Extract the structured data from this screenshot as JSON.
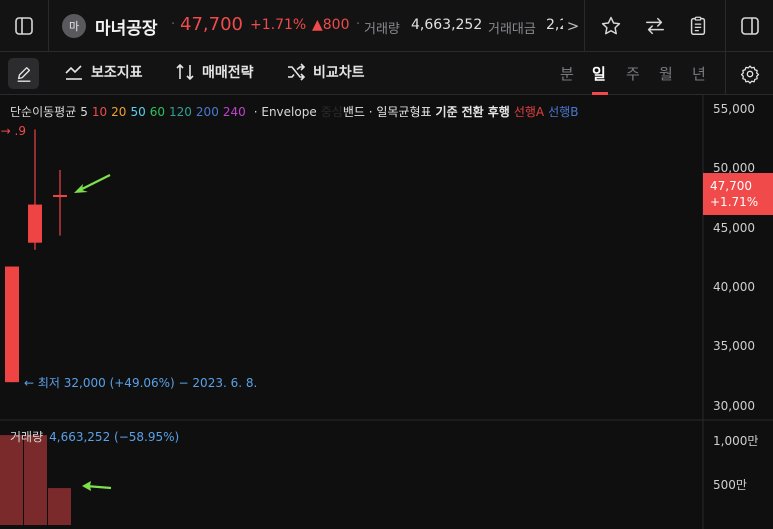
{
  "header": {
    "avatar_text": "마",
    "stock_name": "마녀공장",
    "price": "47,700",
    "change_pct": "+1.71%",
    "change_value": "▲800",
    "volume_label": "거래량",
    "volume_value": "4,663,252",
    "amount_label": "거래대금",
    "amount_value_partial": "2,2",
    "more_glyph": ">"
  },
  "toolbar": {
    "indicators_label": "보조지표",
    "strategy_label": "매매전략",
    "compare_label": "비교차트",
    "periods": [
      "분",
      "일",
      "주",
      "월",
      "년"
    ],
    "active_period": "일"
  },
  "indicators": {
    "sma_label": "단순이동평균",
    "sma_periods": [
      {
        "value": "5",
        "color": "#d8d8d8"
      },
      {
        "value": "10",
        "color": "#f04a4a"
      },
      {
        "value": "20",
        "color": "#f0a030"
      },
      {
        "value": "50",
        "color": "#5ad0f0"
      },
      {
        "value": "60",
        "color": "#30c060"
      },
      {
        "value": "120",
        "color": "#30a090"
      },
      {
        "value": "200",
        "color": "#4a78d0"
      },
      {
        "value": "240",
        "color": "#c040d0"
      }
    ],
    "envelope_label": "· Envelope",
    "envelope_hidden": "중심",
    "band_label": "밴드 · 일목균형표",
    "ichimoku_items": [
      {
        "label": "기준",
        "color": "#e4e4e4"
      },
      {
        "label": "전환",
        "color": "#e4e4e4"
      },
      {
        "label": "후행",
        "color": "#e4e4e4"
      },
      {
        "label": "선행A",
        "color": "#e04040"
      },
      {
        "label": "선행B",
        "color": "#4a78d0"
      }
    ]
  },
  "price_axis": [
    "55,000",
    "50,000",
    "45,000",
    "40,000",
    "35,000",
    "30,000"
  ],
  "current_price_tag": {
    "price": "47,700",
    "pct": "+1.71%"
  },
  "low_annotation": "← 최저 32,000 (+49.06%) − 2023. 6. 8.",
  "top_left_hint": "9. →",
  "volume": {
    "label": "거래량",
    "value": "4,663,252 (−58.95%)",
    "axis": [
      "1,000만",
      "500만"
    ]
  },
  "colors": {
    "up": "#f04a4a",
    "up_candle": "#ef4444",
    "volume_bar": "#7a2a2a",
    "arrow": "#7ee04a",
    "annotation": "#5aa0e6"
  },
  "chart_data": {
    "type": "candlestick",
    "price_range": [
      30000,
      55000
    ],
    "candles": [
      {
        "open": 32000,
        "high": 41700,
        "low": 32000,
        "close": 41700
      },
      {
        "open": 43700,
        "high": 53200,
        "low": 43100,
        "close": 46900
      },
      {
        "open": 47700,
        "high": 49800,
        "low": 44300,
        "close": 47700
      }
    ],
    "volume_range": [
      0,
      12000000
    ],
    "volumes": [
      11360000,
      11360000,
      4663252
    ]
  }
}
